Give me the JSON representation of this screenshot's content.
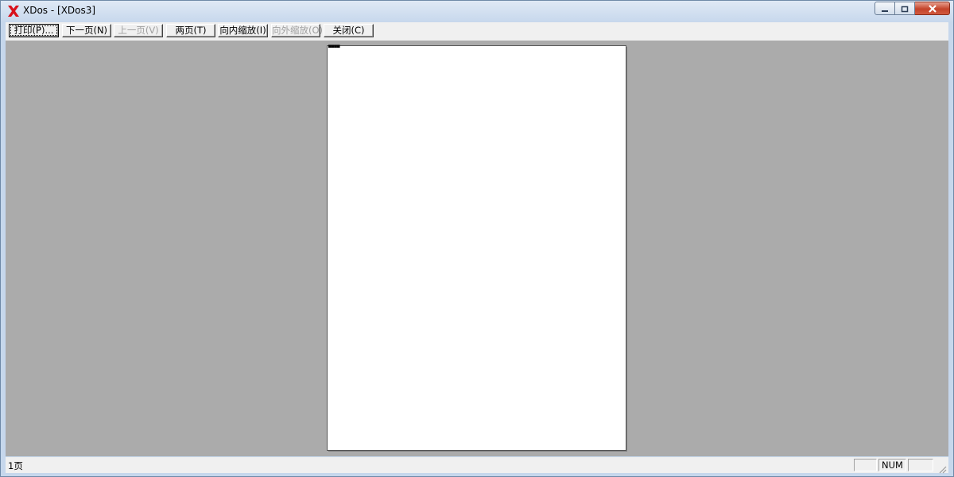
{
  "window": {
    "title": "XDos - [XDos3]",
    "app_icon": "xdos-red-x-icon",
    "accent_color": "#d8101a"
  },
  "toolbar": {
    "buttons": [
      {
        "label": "打印(P)...",
        "enabled": true
      },
      {
        "label": "下一页(N)",
        "enabled": true
      },
      {
        "label": "上一页(V)",
        "enabled": false
      },
      {
        "label": "两页(T)",
        "enabled": true
      },
      {
        "label": "向内缩放(I)",
        "enabled": true
      },
      {
        "label": "向外缩放(O)",
        "enabled": false
      },
      {
        "label": "关闭(C)",
        "enabled": true
      }
    ]
  },
  "preview": {
    "page_text": "▀▀▀▀"
  },
  "statusbar": {
    "page_label": "1页",
    "indicators": [
      "",
      "NUM",
      ""
    ]
  },
  "colors": {
    "workspace_gray": "#ababab",
    "page_white": "#ffffff",
    "close_button_red": "#c4432a"
  }
}
